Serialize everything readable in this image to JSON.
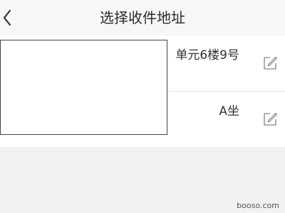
{
  "header": {
    "back_icon": "chevron-left-icon",
    "title": "选择收件地址"
  },
  "addresses": [
    {
      "text": "单元6楼9号",
      "edit_icon": "edit-icon"
    },
    {
      "text": "A坐",
      "edit_icon": "edit-icon"
    }
  ],
  "watermark": "booso.com",
  "colors": {
    "background": "#f2f2f2",
    "card": "#ffffff",
    "icon": "#9a9a9a"
  }
}
